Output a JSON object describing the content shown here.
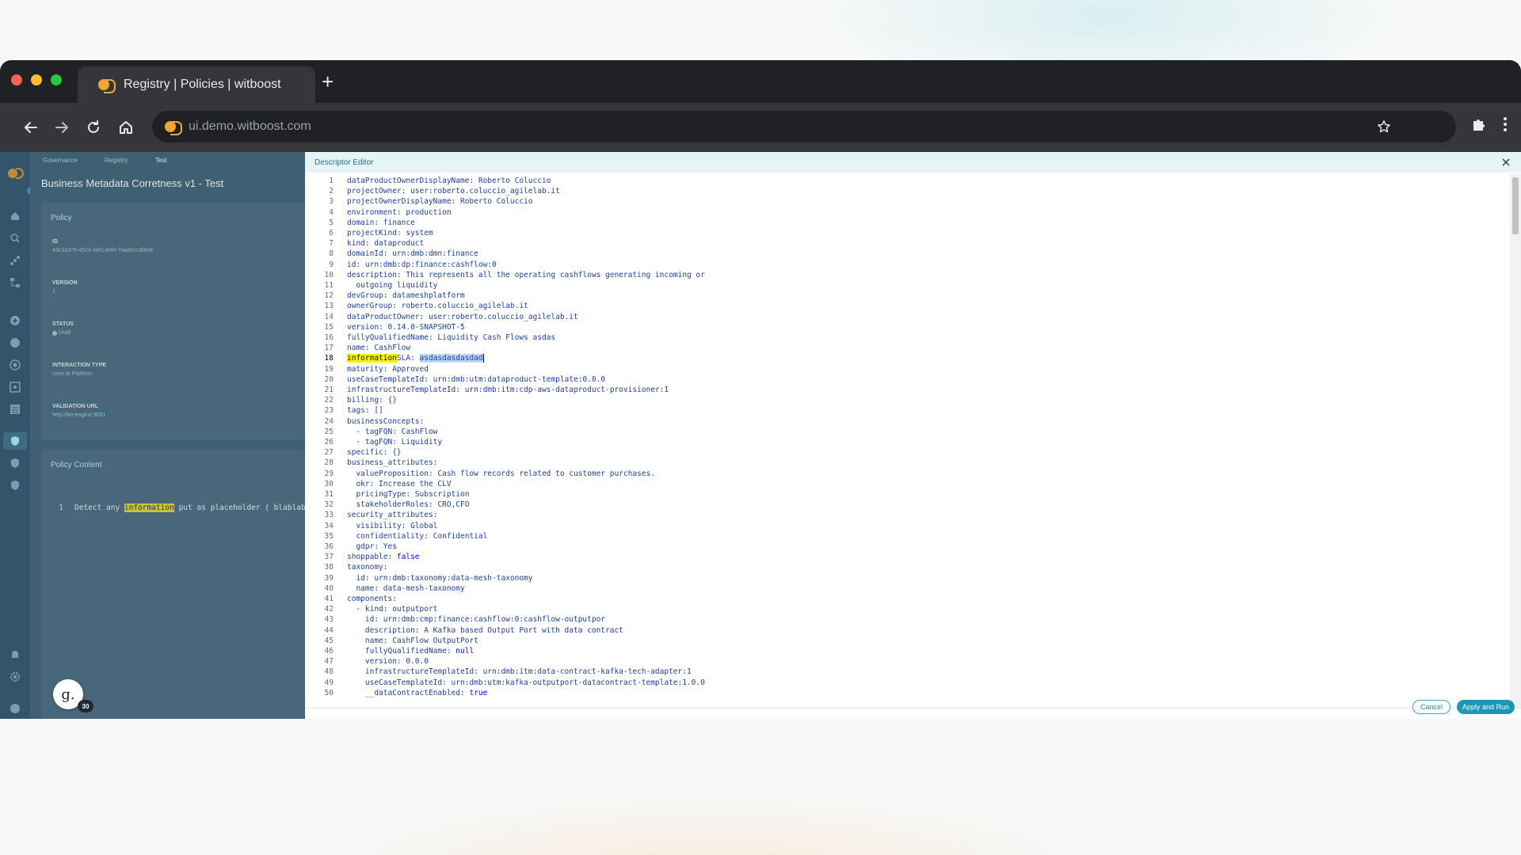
{
  "browser": {
    "tab_title": "Registry | Policies | witboost",
    "url": "ui.demo.witboost.com"
  },
  "app": {
    "breadcrumbs": [
      "Governance",
      "Registry",
      "Test"
    ],
    "title": "Business Metadata Corretness v1 - Test",
    "policy_header": "Policy",
    "fields": [
      {
        "label": "ID",
        "value": "43c1a378-4524-4ef1-a0f4-7aae0ccd0edf"
      },
      {
        "label": "VERSION",
        "value": "1"
      },
      {
        "label": "STATUS",
        "value": "Draft"
      },
      {
        "label": "INTERACTION TYPE",
        "value": "User to Platform"
      },
      {
        "label": "VALIDATION URL",
        "value": "http://llm-engine:9091"
      }
    ],
    "policy_content_header": "Policy Content",
    "policy_content_line_number": "1",
    "policy_content_before": "Detect any ",
    "policy_content_highlight": "information",
    "policy_content_after": " put as placeholder ( blablab",
    "avatar_letter": "g.",
    "avatar_badge": "30"
  },
  "editor": {
    "title": "Descriptor Editor",
    "cancel_label": "Cancel",
    "apply_label": "Apply and Run",
    "highlighted_line": 18,
    "lines": [
      "dataProductOwnerDisplayName: Roberto Coluccio",
      "projectOwner: user:roberto.coluccio_agilelab.it",
      "projectOwnerDisplayName: Roberto Coluccio",
      "environment: production",
      "domain: finance",
      "projectKind: system",
      "kind: dataproduct",
      "domainId: urn:dmb:dmn:finance",
      "id: urn:dmb:dp:finance:cashflow:0",
      "description: This represents all the operating cashflows generating incoming or",
      "  outgoing liquidity",
      "devGroup: datameshplatform",
      "ownerGroup: roberto.coluccio_agilelab.it",
      "dataProductOwner: user:roberto.coluccio_agilelab.it",
      "version: 0.14.0-SNAPSHOT-5",
      "fullyQualifiedName: Liquidity Cash Flows asdas",
      "name: CashFlow",
      "informationSLA: asdasdasdasdad",
      "maturity: Approved",
      "useCaseTemplateId: urn:dmb:utm:dataproduct-template:0.0.0",
      "infrastructureTemplateId: urn:dmb:itm:cdp-aws-dataproduct-provisioner:1",
      "billing: {}",
      "tags: []",
      "businessConcepts:",
      "  - tagFQN: CashFlow",
      "  - tagFQN: Liquidity",
      "specific: {}",
      "business_attributes:",
      "  valueProposition: Cash flow records related to customer purchases.",
      "  okr: Increase the CLV",
      "  pricingType: Subscription",
      "  stakeholderRoles: CRO,CFO",
      "security_attributes:",
      "  visibility: Global",
      "  confidentiality: Confidential",
      "  gdpr: Yes",
      "shoppable: false",
      "taxonomy:",
      "  id: urn:dmb:taxonomy:data-mesh-taxonomy",
      "  name: data-mesh-taxonomy",
      "components:",
      "  - kind: outputport",
      "    id: urn:dmb:cmp:finance:cashflow:0:cashflow-outputpor",
      "    description: A Kafka based Output Port with data contract",
      "    name: CashFlow OutputPort",
      "    fullyQualifiedName: null",
      "    version: 0.0.0",
      "    infrastructureTemplateId: urn:dmb:itm:data-contract-kafka-tech-adapter:1",
      "    useCaseTemplateId: urn:dmb:utm:kafka-outputport-datacontract-template:1.0.0",
      "    __dataContractEnabled: true"
    ]
  }
}
